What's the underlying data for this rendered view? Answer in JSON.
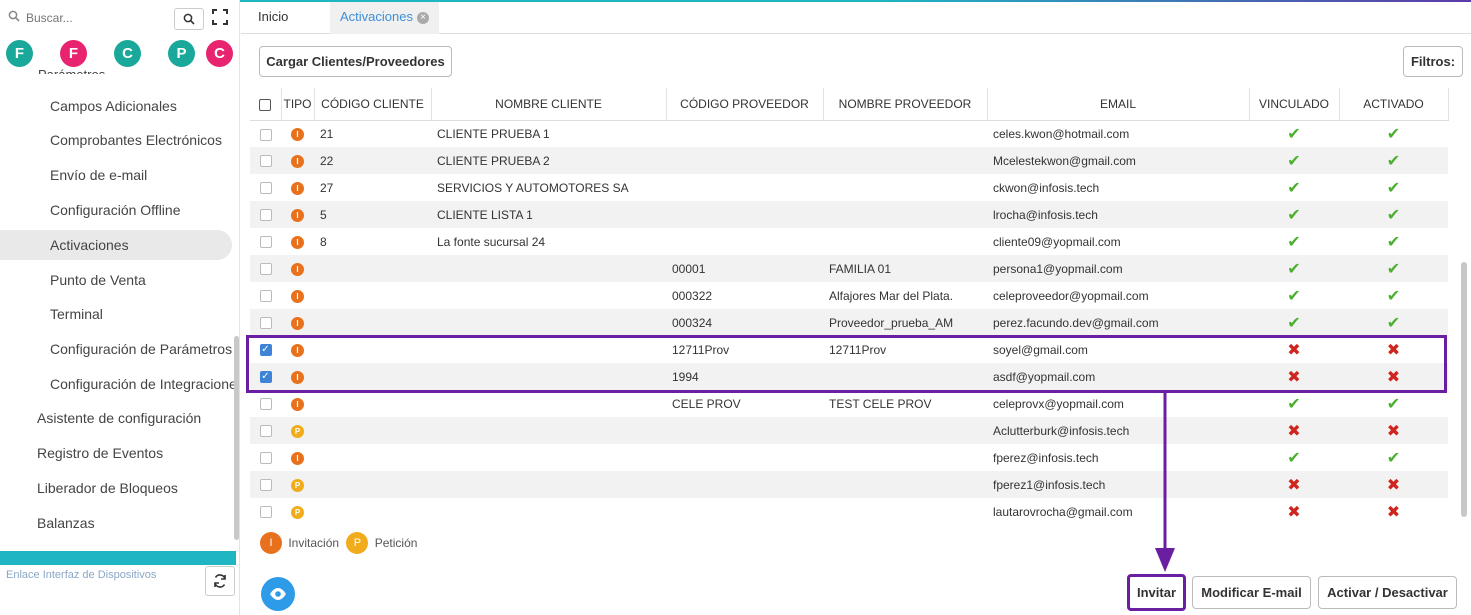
{
  "sidebar": {
    "search_placeholder": "Buscar...",
    "search_button_icon": "search-icon",
    "expand_icon": "expand-icon",
    "shortcuts": [
      {
        "letter": "F",
        "color": "#1aa89b"
      },
      {
        "letter": "F",
        "color": "#e8236f"
      },
      {
        "letter": "C",
        "color": "#1aa89b"
      },
      {
        "letter": "P",
        "color": "#1aa89b"
      },
      {
        "letter": "C",
        "color": "#e8236f"
      }
    ],
    "partial_item": "Parámetros",
    "items": [
      {
        "label": "Campos Adicionales"
      },
      {
        "label": "Comprobantes Electrónicos"
      },
      {
        "label": "Envío de e-mail"
      },
      {
        "label": "Configuración Offline"
      },
      {
        "label": "Activaciones"
      },
      {
        "label": "Punto de Venta"
      },
      {
        "label": "Terminal"
      },
      {
        "label": "Configuración de Parámetros"
      },
      {
        "label": "Configuración de Integraciones"
      },
      {
        "label": "Asistente de configuración"
      },
      {
        "label": "Registro de Eventos"
      },
      {
        "label": "Liberador de Bloqueos"
      },
      {
        "label": "Balanzas"
      }
    ],
    "footer_link": "Enlace Interfaz de Dispositivos"
  },
  "tabs": [
    {
      "label": "Inicio"
    },
    {
      "label": "Activaciones"
    }
  ],
  "toolbar": {
    "load_button": "Cargar Clientes/Proveedores",
    "filters_button": "Filtros:"
  },
  "table": {
    "headers": [
      "",
      "TIPO",
      "CÓDIGO CLIENTE",
      "NOMBRE CLIENTE",
      "CÓDIGO PROVEEDOR",
      "NOMBRE PROVEEDOR",
      "EMAIL",
      "VINCULADO",
      "ACTIVADO"
    ],
    "tipo_letters": {
      "inv": "I",
      "pet": "P"
    },
    "marks": {
      "yes": "✔",
      "no": "✖"
    },
    "rows": [
      {
        "checked": false,
        "tipo": "inv",
        "cod_cli": "21",
        "nom_cli": "CLIENTE PRUEBA 1",
        "cod_prov": "",
        "nom_prov": "",
        "email": "celes.kwon@hotmail.com",
        "vinculado": true,
        "activado": true
      },
      {
        "checked": false,
        "tipo": "inv",
        "cod_cli": "22",
        "nom_cli": "CLIENTE PRUEBA 2",
        "cod_prov": "",
        "nom_prov": "",
        "email": "Mcelestekwon@gmail.com",
        "vinculado": true,
        "activado": true
      },
      {
        "checked": false,
        "tipo": "inv",
        "cod_cli": "27",
        "nom_cli": "SERVICIOS Y AUTOMOTORES SA",
        "cod_prov": "",
        "nom_prov": "",
        "email": "ckwon@infosis.tech",
        "vinculado": true,
        "activado": true
      },
      {
        "checked": false,
        "tipo": "inv",
        "cod_cli": "5",
        "nom_cli": "CLIENTE LISTA 1",
        "cod_prov": "",
        "nom_prov": "",
        "email": "lrocha@infosis.tech",
        "vinculado": true,
        "activado": true
      },
      {
        "checked": false,
        "tipo": "inv",
        "cod_cli": "8",
        "nom_cli": "La fonte sucursal 24",
        "cod_prov": "",
        "nom_prov": "",
        "email": "cliente09@yopmail.com",
        "vinculado": true,
        "activado": true
      },
      {
        "checked": false,
        "tipo": "inv",
        "cod_cli": "",
        "nom_cli": "",
        "cod_prov": "00001",
        "nom_prov": "FAMILIA 01",
        "email": "persona1@yopmail.com",
        "vinculado": true,
        "activado": true
      },
      {
        "checked": false,
        "tipo": "inv",
        "cod_cli": "",
        "nom_cli": "",
        "cod_prov": "000322",
        "nom_prov": "Alfajores Mar del Plata.",
        "email": "celeproveedor@yopmail.com",
        "vinculado": true,
        "activado": true
      },
      {
        "checked": false,
        "tipo": "inv",
        "cod_cli": "",
        "nom_cli": "",
        "cod_prov": "000324",
        "nom_prov": "Proveedor_prueba_AM",
        "email": "perez.facundo.dev@gmail.com",
        "vinculado": true,
        "activado": true
      },
      {
        "checked": true,
        "tipo": "inv",
        "cod_cli": "",
        "nom_cli": "",
        "cod_prov": "12711Prov",
        "nom_prov": "12711Prov",
        "email": "soyel@gmail.com",
        "vinculado": false,
        "activado": false
      },
      {
        "checked": true,
        "tipo": "inv",
        "cod_cli": "",
        "nom_cli": "",
        "cod_prov": "1994",
        "nom_prov": "",
        "email": "asdf@yopmail.com",
        "vinculado": false,
        "activado": false
      },
      {
        "checked": false,
        "tipo": "inv",
        "cod_cli": "",
        "nom_cli": "",
        "cod_prov": "CELE PROV",
        "nom_prov": "TEST CELE PROV",
        "email": "celeprovx@yopmail.com",
        "vinculado": true,
        "activado": true
      },
      {
        "checked": false,
        "tipo": "pet",
        "cod_cli": "",
        "nom_cli": "",
        "cod_prov": "",
        "nom_prov": "",
        "email": "Aclutterburk@infosis.tech",
        "vinculado": false,
        "activado": false
      },
      {
        "checked": false,
        "tipo": "inv",
        "cod_cli": "",
        "nom_cli": "",
        "cod_prov": "",
        "nom_prov": "",
        "email": "fperez@infosis.tech",
        "vinculado": true,
        "activado": true
      },
      {
        "checked": false,
        "tipo": "pet",
        "cod_cli": "",
        "nom_cli": "",
        "cod_prov": "",
        "nom_prov": "",
        "email": "fperez1@infosis.tech",
        "vinculado": false,
        "activado": false
      },
      {
        "checked": false,
        "tipo": "pet",
        "cod_cli": "",
        "nom_cli": "",
        "cod_prov": "",
        "nom_prov": "",
        "email": "lautarovrocha@gmail.com",
        "vinculado": false,
        "activado": false
      }
    ]
  },
  "legend": [
    {
      "letter": "I",
      "label": "Invitación",
      "color": "#e8711d"
    },
    {
      "letter": "P",
      "label": "Petición",
      "color": "#f1ac1c"
    }
  ],
  "actions": {
    "invite": "Invitar",
    "modify_email": "Modificar E-mail",
    "toggle": "Activar / Desactivar"
  },
  "annotation_color": "#6a1fa3"
}
